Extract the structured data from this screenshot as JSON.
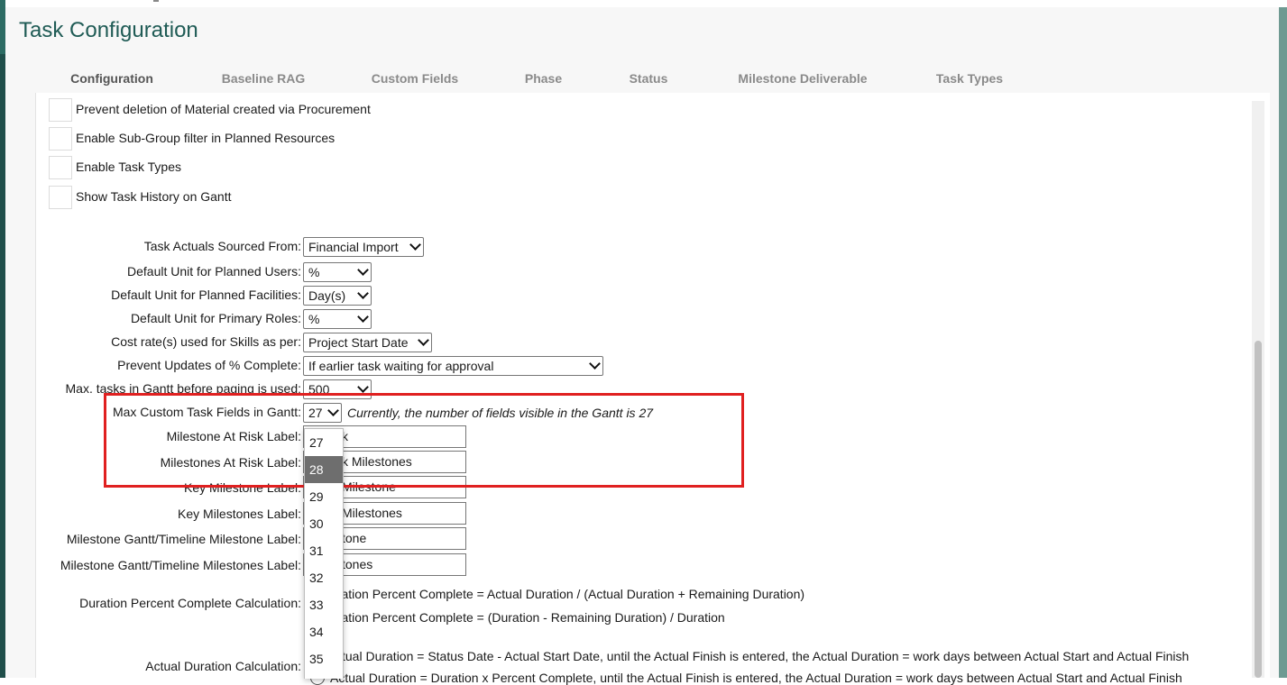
{
  "page": {
    "title": "Task Configuration"
  },
  "tabs": [
    {
      "label": "Configuration",
      "active": true
    },
    {
      "label": "Baseline RAG"
    },
    {
      "label": "Custom Fields"
    },
    {
      "label": "Phase"
    },
    {
      "label": "Status"
    },
    {
      "label": "Milestone Deliverable"
    },
    {
      "label": "Task Types"
    }
  ],
  "checkboxes": [
    {
      "label": "Prevent deletion of Material created via Procurement",
      "checked": false
    },
    {
      "label": "Enable Sub-Group filter in Planned Resources",
      "checked": false
    },
    {
      "label": "Enable Task Types",
      "checked": false
    },
    {
      "label": "Show Task History on Gantt",
      "checked": false
    }
  ],
  "fields": {
    "task_actuals_source": {
      "label": "Task Actuals Sourced From:",
      "value": "Financial Import"
    },
    "unit_planned_users": {
      "label": "Default Unit for Planned Users:",
      "value": "%"
    },
    "unit_planned_facilities": {
      "label": "Default Unit for Planned Facilities:",
      "value": "Day(s)"
    },
    "unit_primary_roles": {
      "label": "Default Unit for Primary Roles:",
      "value": "%"
    },
    "cost_rate_skills": {
      "label": "Cost rate(s) used for Skills as per:",
      "value": "Project Start Date"
    },
    "prevent_updates_complete": {
      "label": "Prevent Updates of % Complete:",
      "value": "If earlier task waiting for approval"
    },
    "max_tasks_paging": {
      "label": "Max. tasks in Gantt before paging is used:",
      "value": "500"
    },
    "max_custom_fields": {
      "label": "Max Custom Task Fields in Gantt:",
      "value": "27",
      "note": "Currently, the number of fields visible in the Gantt is 27"
    },
    "milestone_at_risk": {
      "label": "Milestone At Risk Label:",
      "visible_value": "k"
    },
    "milestones_at_risk": {
      "label": "Milestones At Risk Label:",
      "visible_value": "k Milestones"
    },
    "key_milestone": {
      "label": "Key Milestone Label:",
      "visible_value": "Milestone"
    },
    "key_milestones": {
      "label": "Key Milestones Label:",
      "visible_value": "Milestones"
    },
    "timeline_milestone": {
      "label": "Milestone Gantt/Timeline Milestone Label:",
      "visible_value": "tone"
    },
    "timeline_milestones": {
      "label": "Milestone Gantt/Timeline Milestones Label:",
      "visible_value": "tones"
    },
    "duration_percent": {
      "label": "Duration Percent Complete Calculation:",
      "options": [
        "uration Percent Complete = Actual Duration / (Actual Duration + Remaining Duration)",
        "uration Percent Complete = (Duration - Remaining Duration) / Duration"
      ]
    },
    "actual_duration": {
      "label": "Actual Duration Calculation:",
      "options": [
        "ctual Duration = Status Date - Actual Start Date, until the Actual Finish is entered, the Actual Duration = work days between Actual Start and Actual Finish",
        "Actual Duration = Duration x Percent Complete, until the Actual Finish is entered, the Actual Duration = work days between Actual Start and Actual Finish"
      ]
    }
  },
  "dropdown_open": {
    "options": [
      "27",
      "28",
      "29",
      "30",
      "31",
      "32",
      "33",
      "34",
      "35"
    ],
    "highlighted": "28"
  },
  "colors": {
    "accent": "#1f5b55",
    "highlight_box": "#e02020",
    "option_highlight": "#6e6e6e"
  }
}
